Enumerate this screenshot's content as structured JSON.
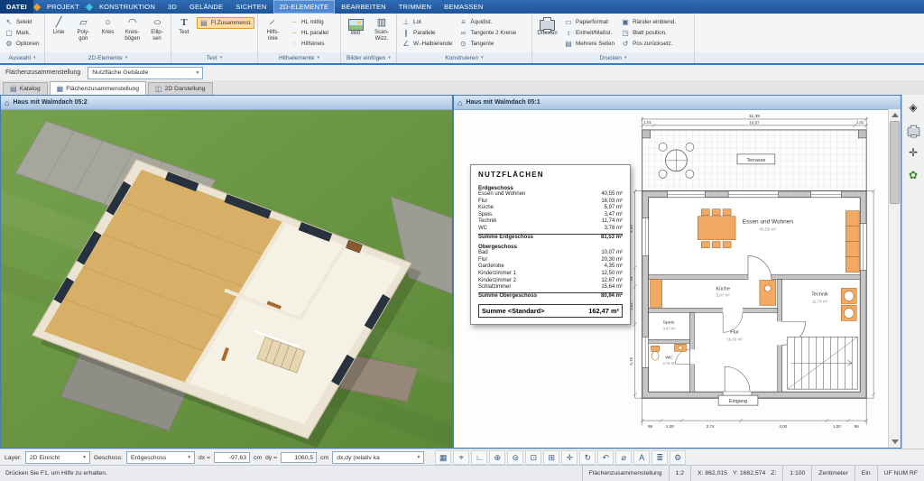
{
  "menu": {
    "tabs": [
      "DATEI",
      "PROJEKT",
      "KONSTRUKTION",
      "3D",
      "GELÄNDE",
      "SICHTEN",
      "2D-ELEMENTE",
      "BEARBEITEN",
      "TRIMMEN",
      "BEMASSEN"
    ]
  },
  "ribbon": {
    "auswahl": {
      "label": "Auswahl",
      "selekt": "Selekt",
      "mark": "Mark.",
      "optionen": "Optionen"
    },
    "elemente": {
      "label": "2D-Elemente",
      "linie": "Linie",
      "polygon": "Poly-\ngon",
      "kreis": "Kreis",
      "kreisboegen": "Kreis-\nbögen",
      "ellipsen": "Ellip-\nsen"
    },
    "text": {
      "label": "Text",
      "flzusammenst": "Fl.Zusammenst.",
      "text": "Text"
    },
    "hilfs": {
      "label": "Hilfselemente",
      "hl_mittig": "HL mittig",
      "hl_parallel": "HL parallel",
      "hilfskreis": "Hilfskreis",
      "hilfslinie": "Hilfs-\nlinie"
    },
    "bilder": {
      "label": "Bilder einfügen",
      "bild": "Bild",
      "scanwizz": "Scan-\nWizz."
    },
    "konstruieren": {
      "label": "Konstruieren",
      "lot": "Lot",
      "parallele": "Parallele",
      "whalbierende": "W.-Halbierende",
      "aequidist": "Äquidist.",
      "tangente2": "Tangente 2 Kreise",
      "tangente": "Tangente"
    },
    "drucken": {
      "label": "Drucken",
      "drucken": "Drucken",
      "papierformat": "Papierformat",
      "einheit": "Einheit/Maßst.",
      "mehrere": "Mehrere Seiten",
      "raender": "Ränder einblend.",
      "blatt": "Blatt position.",
      "pos": "Pos zurücksetz."
    }
  },
  "breadcrumb": {
    "label": "Flächenzusammenstellung",
    "combo": "Nutzfläche Gebäude"
  },
  "view_tabs": [
    {
      "label": "Katalog"
    },
    {
      "label": "Flächenzusammenstellung"
    },
    {
      "label": "2D Darstellung"
    }
  ],
  "panes": {
    "left_title": "Haus mit Walmdach 05:2",
    "right_title": "Haus mit Walmdach 05:1"
  },
  "nutzflaechen": {
    "title": "NUTZFLÄCHEN",
    "sections": [
      {
        "header": "Erdgeschoss",
        "rows": [
          [
            "Essen und Wohnen",
            "40,55 m²"
          ],
          [
            "Flur",
            "16,03 m²"
          ],
          [
            "Küche",
            "5,97 m²"
          ],
          [
            "Speis.",
            "3,47 m²"
          ],
          [
            "Technik",
            "11,74 m²"
          ],
          [
            "WC",
            "3,78 m²"
          ]
        ],
        "sum_label": "Summe Erdgeschoss",
        "sum_value": "81,53 m²"
      },
      {
        "header": "Obergeschoss",
        "rows": [
          [
            "Bad",
            "10,07 m²"
          ],
          [
            "Flur",
            "20,30 m²"
          ],
          [
            "Garderobe",
            "4,35 m²"
          ],
          [
            "Kinderzimmer 1",
            "12,50 m²"
          ],
          [
            "Kinderzimmer 2",
            "12,67 m²"
          ],
          [
            "Schlafzimmer",
            "15,64 m²"
          ]
        ],
        "sum_label": "Summe Obergeschoss",
        "sum_value": "80,94 m²"
      }
    ],
    "total_label": "Summe <Standard>",
    "total_value": "162,47 m²"
  },
  "plan": {
    "rooms": {
      "terrasse": "Terrasse",
      "essen": "Essen und Wohnen",
      "essen_area": "40,55 m²",
      "kueche": "Küche",
      "kueche_area": "5,97 m²",
      "speis": "Speis.",
      "speis_area": "3,47 m²",
      "flur": "Flur",
      "flur_area": "16,03 m²",
      "wc": "WC",
      "wc_area": "3,78 m²",
      "technik": "Technik",
      "technik_area": "11,74 m²",
      "eingang": "Eingang"
    },
    "dims": {
      "top_overall": "11,39",
      "top_left": "1,01",
      "top_mid": "10,97",
      "top_right": "1,01",
      "bottom": [
        "86",
        "1,00",
        "2,74",
        "4,00",
        "1,00",
        "86"
      ],
      "left": [
        "3,99",
        "91",
        "2,01",
        "5,75"
      ]
    }
  },
  "bottom": {
    "layer_label": "Layer:",
    "layer_value": "2D Einricht",
    "geschoss_label": "Geschoss:",
    "geschoss_value": "Erdgeschoss",
    "dx_label": "dx =",
    "dx_value": "-97,63",
    "dx_unit": "cm",
    "dy_label": "dy =",
    "dy_value": "1060,5",
    "dy_unit": "cm",
    "mode_value": "dx,dy (relativ ka"
  },
  "status": {
    "help": "Drücken Sie F1, um Hilfe zu erhalten.",
    "context": "Flächenzusammenstellung",
    "ratio": "1:2",
    "x": "X: 862,015",
    "y": "Y: 1662,574",
    "z": "Z:",
    "scale": "1:100",
    "unit": "Zentimeter",
    "state": "Ein",
    "keys": "UF NUM RF"
  },
  "icons": {
    "selekt": "↖",
    "mark": "▢",
    "optionen": "⚙",
    "linie": "╱",
    "polygon": "▱",
    "kreis": "○",
    "kreisbogen": "◠",
    "ellipse": "○",
    "flzus": "▤",
    "text": "T",
    "hl": "┄",
    "hilfskreis": "◌",
    "hilfslinie": "┄",
    "scan": "▥",
    "lot": "⊥",
    "parallele": "∥",
    "whalbierende": "∠",
    "aequidist": "≡",
    "tangente2": "∞",
    "tangente": "⊙",
    "papierformat": "▭",
    "einheit": "↕",
    "mehrere": "▤",
    "raender": "▣",
    "blatt": "◳",
    "pos": "↺",
    "katalog": "▤",
    "flaechen_tab": "▦",
    "darstellung": "◫",
    "haus": "⌂",
    "layers": "◈",
    "move": "✛",
    "plant": "✿",
    "bottom": [
      {
        "name": "grid-icon",
        "glyph": "▦"
      },
      {
        "name": "snap-icon",
        "glyph": "⌖"
      },
      {
        "name": "ortho-icon",
        "glyph": "∟"
      },
      {
        "name": "zoom-in-icon",
        "glyph": "⊕"
      },
      {
        "name": "zoom-out-icon",
        "glyph": "⊖"
      },
      {
        "name": "zoom-window-icon",
        "glyph": "⊡"
      },
      {
        "name": "zoom-all-icon",
        "glyph": "⊞"
      },
      {
        "name": "pan-icon",
        "glyph": "✛"
      },
      {
        "name": "redraw-icon",
        "glyph": "↻"
      },
      {
        "name": "previous-view-icon",
        "glyph": "↶"
      },
      {
        "name": "measure-icon",
        "glyph": "⌀"
      },
      {
        "name": "text-tool-icon",
        "glyph": "A"
      },
      {
        "name": "list-icon",
        "glyph": "≣"
      },
      {
        "name": "settings-icon",
        "glyph": "⚙"
      }
    ]
  }
}
